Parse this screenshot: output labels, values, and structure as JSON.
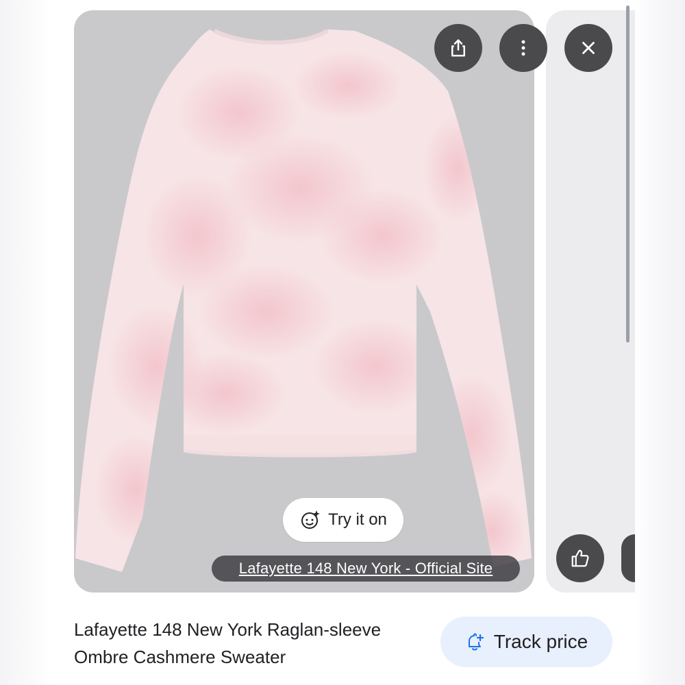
{
  "card": {
    "image_alt": "pink and white tie-dye raglan sweater",
    "try_on_label": "Try it on",
    "source_label": "Lafayette 148 New York - Official Site"
  },
  "actions": {
    "share_icon": "share-icon",
    "more_icon": "more-vert-icon",
    "close_icon": "close-icon",
    "like_icon": "thumbs-up-icon"
  },
  "product": {
    "title_line1": "Lafayette 148 New York Raglan-sleeve",
    "title_line2": "Ombre Cashmere Sweater",
    "track_label": "Track price",
    "track_icon": "bell-add-icon"
  },
  "colors": {
    "card_bg": "#c9c9cc",
    "button_dark": "#4a4a4d",
    "track_bg": "#e8effd",
    "accent_blue": "#1a73e8",
    "sweater_pink": "#f3cdd2"
  }
}
